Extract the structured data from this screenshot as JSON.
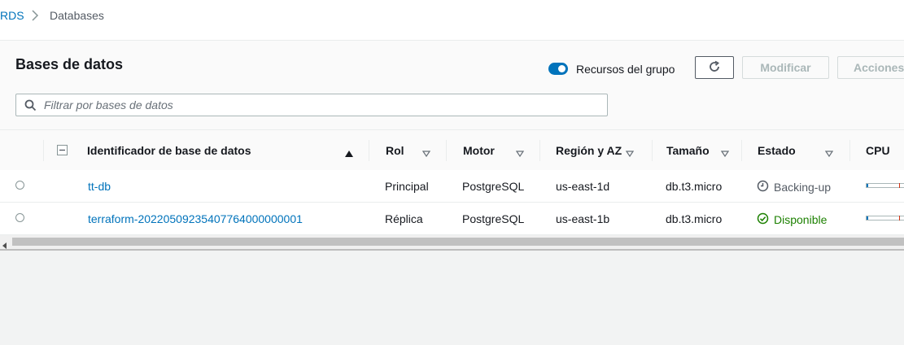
{
  "breadcrumb": {
    "root": "RDS",
    "current": "Databases"
  },
  "header": {
    "title": "Bases de datos",
    "toggle_label": "Recursos del grupo",
    "toggle_on": true,
    "modify_label": "Modificar",
    "actions_label": "Acciones"
  },
  "filter": {
    "placeholder": "Filtrar por bases de datos"
  },
  "table": {
    "columns": {
      "id": "Identificador de base de datos",
      "role": "Rol",
      "engine": "Motor",
      "region": "Región y AZ",
      "size": "Tamaño",
      "status": "Estado",
      "cpu": "CPU"
    },
    "rows": [
      {
        "id": "tt-db",
        "role": "Principal",
        "engine": "PostgreSQL",
        "region": "us-east-1d",
        "size": "db.t3.micro",
        "status": "Backing-up",
        "status_icon": "clock-icon",
        "cpu_percent": 3
      },
      {
        "id": "terraform-20220509235407764000000001",
        "role": "Réplica",
        "engine": "PostgreSQL",
        "region": "us-east-1b",
        "size": "db.t3.micro",
        "status": "Disponible",
        "status_icon": "check-circle-icon",
        "cpu_percent": 3
      }
    ]
  },
  "colors": {
    "link": "#0073bb",
    "available": "#1d8102",
    "toggle": "#0073bb"
  }
}
